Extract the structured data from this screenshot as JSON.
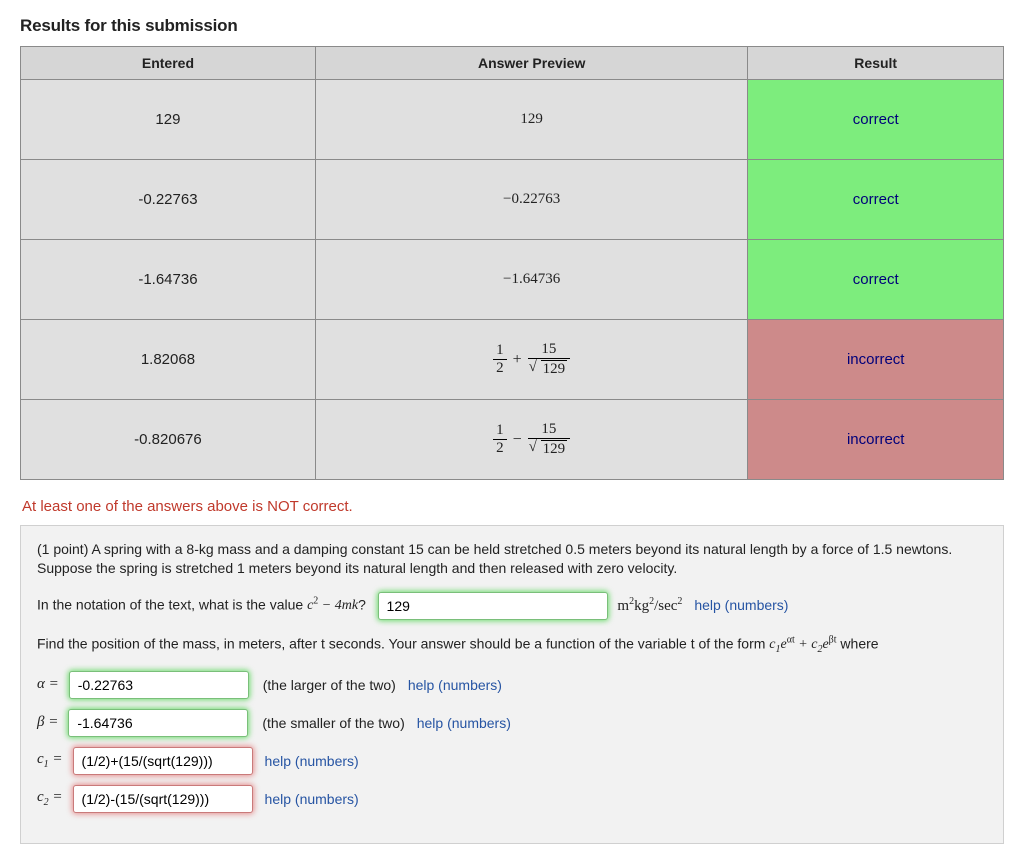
{
  "title": "Results for this submission",
  "headers": {
    "entered": "Entered",
    "preview": "Answer Preview",
    "result": "Result"
  },
  "rows": [
    {
      "entered": "129",
      "preview": "129",
      "result": "correct",
      "resultClass": "correct",
      "short": true
    },
    {
      "entered": "-0.22763",
      "preview": "−0.22763",
      "result": "correct",
      "resultClass": "correct",
      "short": false
    },
    {
      "entered": "-1.64736",
      "preview": "−1.64736",
      "result": "correct",
      "resultClass": "correct",
      "short": false
    },
    {
      "entered": "1.82068",
      "preview_frac": {
        "a": "1",
        "b": "2",
        "op": "+",
        "c": "15",
        "d_sqrt": "129"
      },
      "result": "incorrect",
      "resultClass": "incorrect",
      "short": false
    },
    {
      "entered": "-0.820676",
      "preview_frac": {
        "a": "1",
        "b": "2",
        "op": "−",
        "c": "15",
        "d_sqrt": "129"
      },
      "result": "incorrect",
      "resultClass": "incorrect",
      "short": false
    }
  ],
  "warning": "At least one of the answers above is NOT correct.",
  "problem": {
    "intro": "(1 point) A spring with a 8-kg mass and a damping constant 15 can be held stretched 0.5 meters beyond its natural length by a force of 1.5 newtons. Suppose the spring is stretched 1 meters beyond its natural length and then released with zero velocity.",
    "q1_pre": "In the notation of the text, what is the value ",
    "q1_expr": "c² − 4mk",
    "q1_post": "?",
    "q1_value": "129",
    "q1_units": "m²kg²/sec²",
    "find_pos_pre": "Find the position of the mass, in meters, after t seconds. Your answer should be a function of the variable t of the form ",
    "find_pos_post": " where",
    "alpha_label": "α =",
    "alpha_value": "-0.22763",
    "alpha_aux": "(the larger of the two)",
    "beta_label": "β =",
    "beta_value": "-1.64736",
    "beta_aux": "(the smaller of the two)",
    "c1_label": "c₁ =",
    "c1_value": "(1/2)+(15/(sqrt(129)))",
    "c2_label": "c₂ =",
    "c2_value": "(1/2)-(15/(sqrt(129)))",
    "help_text": "help (numbers)"
  }
}
